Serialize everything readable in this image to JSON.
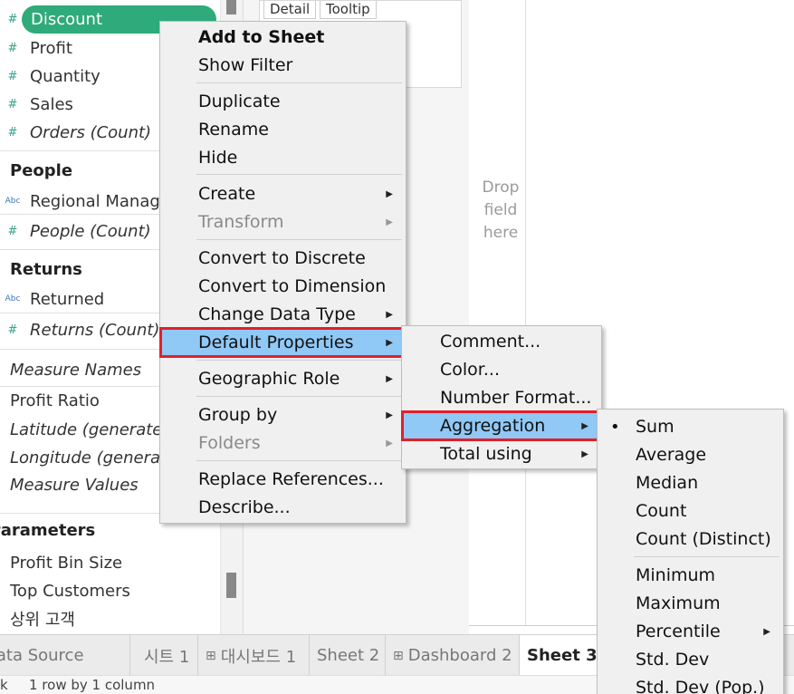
{
  "data_pane": {
    "measures": [
      {
        "icon": "#",
        "label": "Discount",
        "italic": false
      },
      {
        "icon": "#",
        "label": "Profit",
        "italic": false
      },
      {
        "icon": "#",
        "label": "Quantity",
        "italic": false
      },
      {
        "icon": "#",
        "label": "Sales",
        "italic": false
      },
      {
        "icon": "#",
        "label": "Orders (Count)",
        "italic": true
      }
    ],
    "people_header": "People",
    "people": [
      {
        "icon": "Abc",
        "label": "Regional Manager"
      },
      {
        "icon": "#",
        "label": "People (Count)"
      }
    ],
    "returns_header": "Returns",
    "returns": [
      {
        "icon": "Abc",
        "label": "Returned"
      },
      {
        "icon": "#",
        "label": "Returns (Count)"
      }
    ],
    "misc": [
      "Measure Names",
      "Profit Ratio",
      "Latitude (generated)",
      "Longitude (generated)",
      "Measure Values"
    ],
    "parameters_header": "Parameters",
    "parameters": [
      "Profit Bin Size",
      "Top Customers",
      "상위 고객"
    ]
  },
  "marks": {
    "detail": "Detail",
    "tooltip": "Tooltip"
  },
  "canvas": {
    "drop_hint_1": "Drop",
    "drop_hint_2": "field",
    "drop_hint_3": "here"
  },
  "tabs": {
    "data_source": "Data Source",
    "sheet1": "시트 1",
    "dashboard1": "대시보드 1",
    "sheet2": "Sheet 2",
    "dashboard2": "Dashboard 2",
    "sheet3": "Sheet 3"
  },
  "status": {
    "left": "k",
    "rows": "1 row by 1 column"
  },
  "context_menu": {
    "add_to_sheet": "Add to Sheet",
    "show_filter": "Show Filter",
    "duplicate": "Duplicate",
    "rename": "Rename",
    "hide": "Hide",
    "create": "Create",
    "transform": "Transform",
    "convert_discrete": "Convert to Discrete",
    "convert_dimension": "Convert to Dimension",
    "change_type": "Change Data Type",
    "default_properties": "Default Properties",
    "geographic_role": "Geographic Role",
    "group_by": "Group by",
    "folders": "Folders",
    "replace_refs": "Replace References...",
    "describe": "Describe..."
  },
  "default_props_menu": {
    "comment": "Comment...",
    "color": "Color...",
    "number_format": "Number Format...",
    "aggregation": "Aggregation",
    "total_using": "Total using"
  },
  "aggregation_menu": {
    "sum": "Sum",
    "average": "Average",
    "median": "Median",
    "count": "Count",
    "count_distinct": "Count (Distinct)",
    "minimum": "Minimum",
    "maximum": "Maximum",
    "percentile": "Percentile",
    "std_dev": "Std. Dev",
    "std_dev_pop": "Std. Dev (Pop.)"
  },
  "colors": {
    "pill": "#2faa7a",
    "highlight": "#90c8f6",
    "focus_box": "#e0202a"
  }
}
